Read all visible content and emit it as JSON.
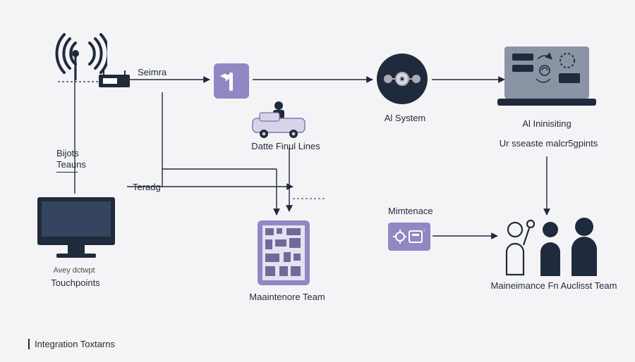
{
  "diagram": {
    "footer": "Integration Toxtarns",
    "nodes": {
      "antenna": {
        "kind": "antenna"
      },
      "router": {
        "kind": "router"
      },
      "seimra": {
        "label": "Seimra"
      },
      "bijots": {
        "label": "Bijots\nTeauns"
      },
      "teradg": {
        "label": "Teradg"
      },
      "monitor": {
        "kind": "monitor",
        "avey": "Avey dctwpt",
        "touchpoints": "Touchpoints"
      },
      "purple_sign": {
        "kind": "direction-sign"
      },
      "van": {
        "kind": "van",
        "label": "Datte Finul Lines"
      },
      "tablet": {
        "kind": "tablet",
        "label": "Maaintenore Team"
      },
      "ai_system": {
        "kind": "ai-circle",
        "label": "Al System"
      },
      "laptop": {
        "kind": "laptop",
        "label1": "Al Ininisiting",
        "label2": "Ur sseaste malcr5gpints"
      },
      "maint": {
        "kind": "maint-panel",
        "label": "Mimtenace"
      },
      "team": {
        "kind": "people",
        "label": "Maineimance Fn Auclisst Team"
      }
    }
  }
}
